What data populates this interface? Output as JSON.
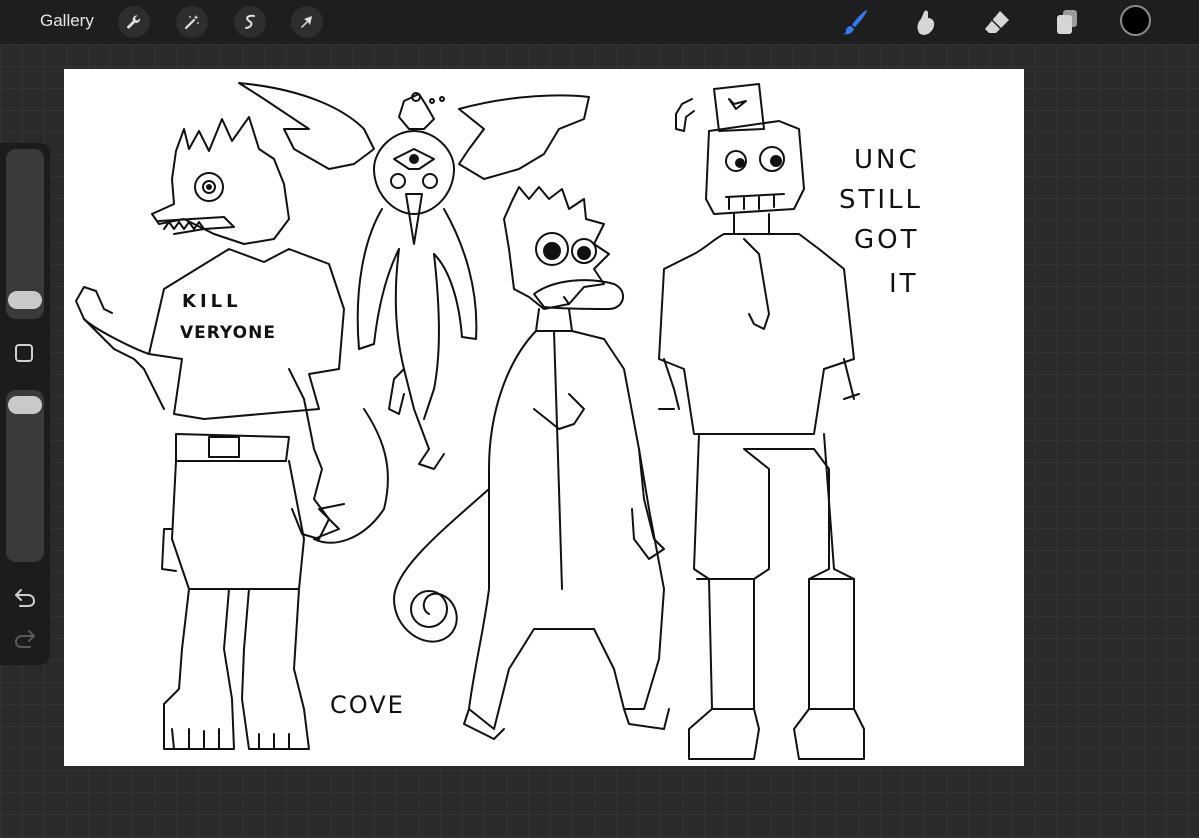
{
  "toolbar": {
    "gallery_label": "Gallery",
    "left_tools": [
      "wrench-icon",
      "magic-wand-icon",
      "selection-icon",
      "transform-arrow-icon"
    ],
    "right_tools": [
      "brush-icon",
      "smudge-icon",
      "eraser-icon",
      "layers-icon"
    ],
    "active_tool": "brush",
    "active_color": "#000000",
    "brush_accent": "#2f7cf6"
  },
  "sidebar": {
    "size_slider_level": 0.15,
    "opacity_slider_level": 1.0
  },
  "canvas": {
    "background": "#ffffff",
    "texts": {
      "shirt_line1": "KILL",
      "shirt_line2": "VERYONE",
      "note_line1": "UNC",
      "note_line2": "STILL",
      "note_line3": "GOT",
      "note_line4": "IT",
      "signature": "COVE"
    }
  }
}
